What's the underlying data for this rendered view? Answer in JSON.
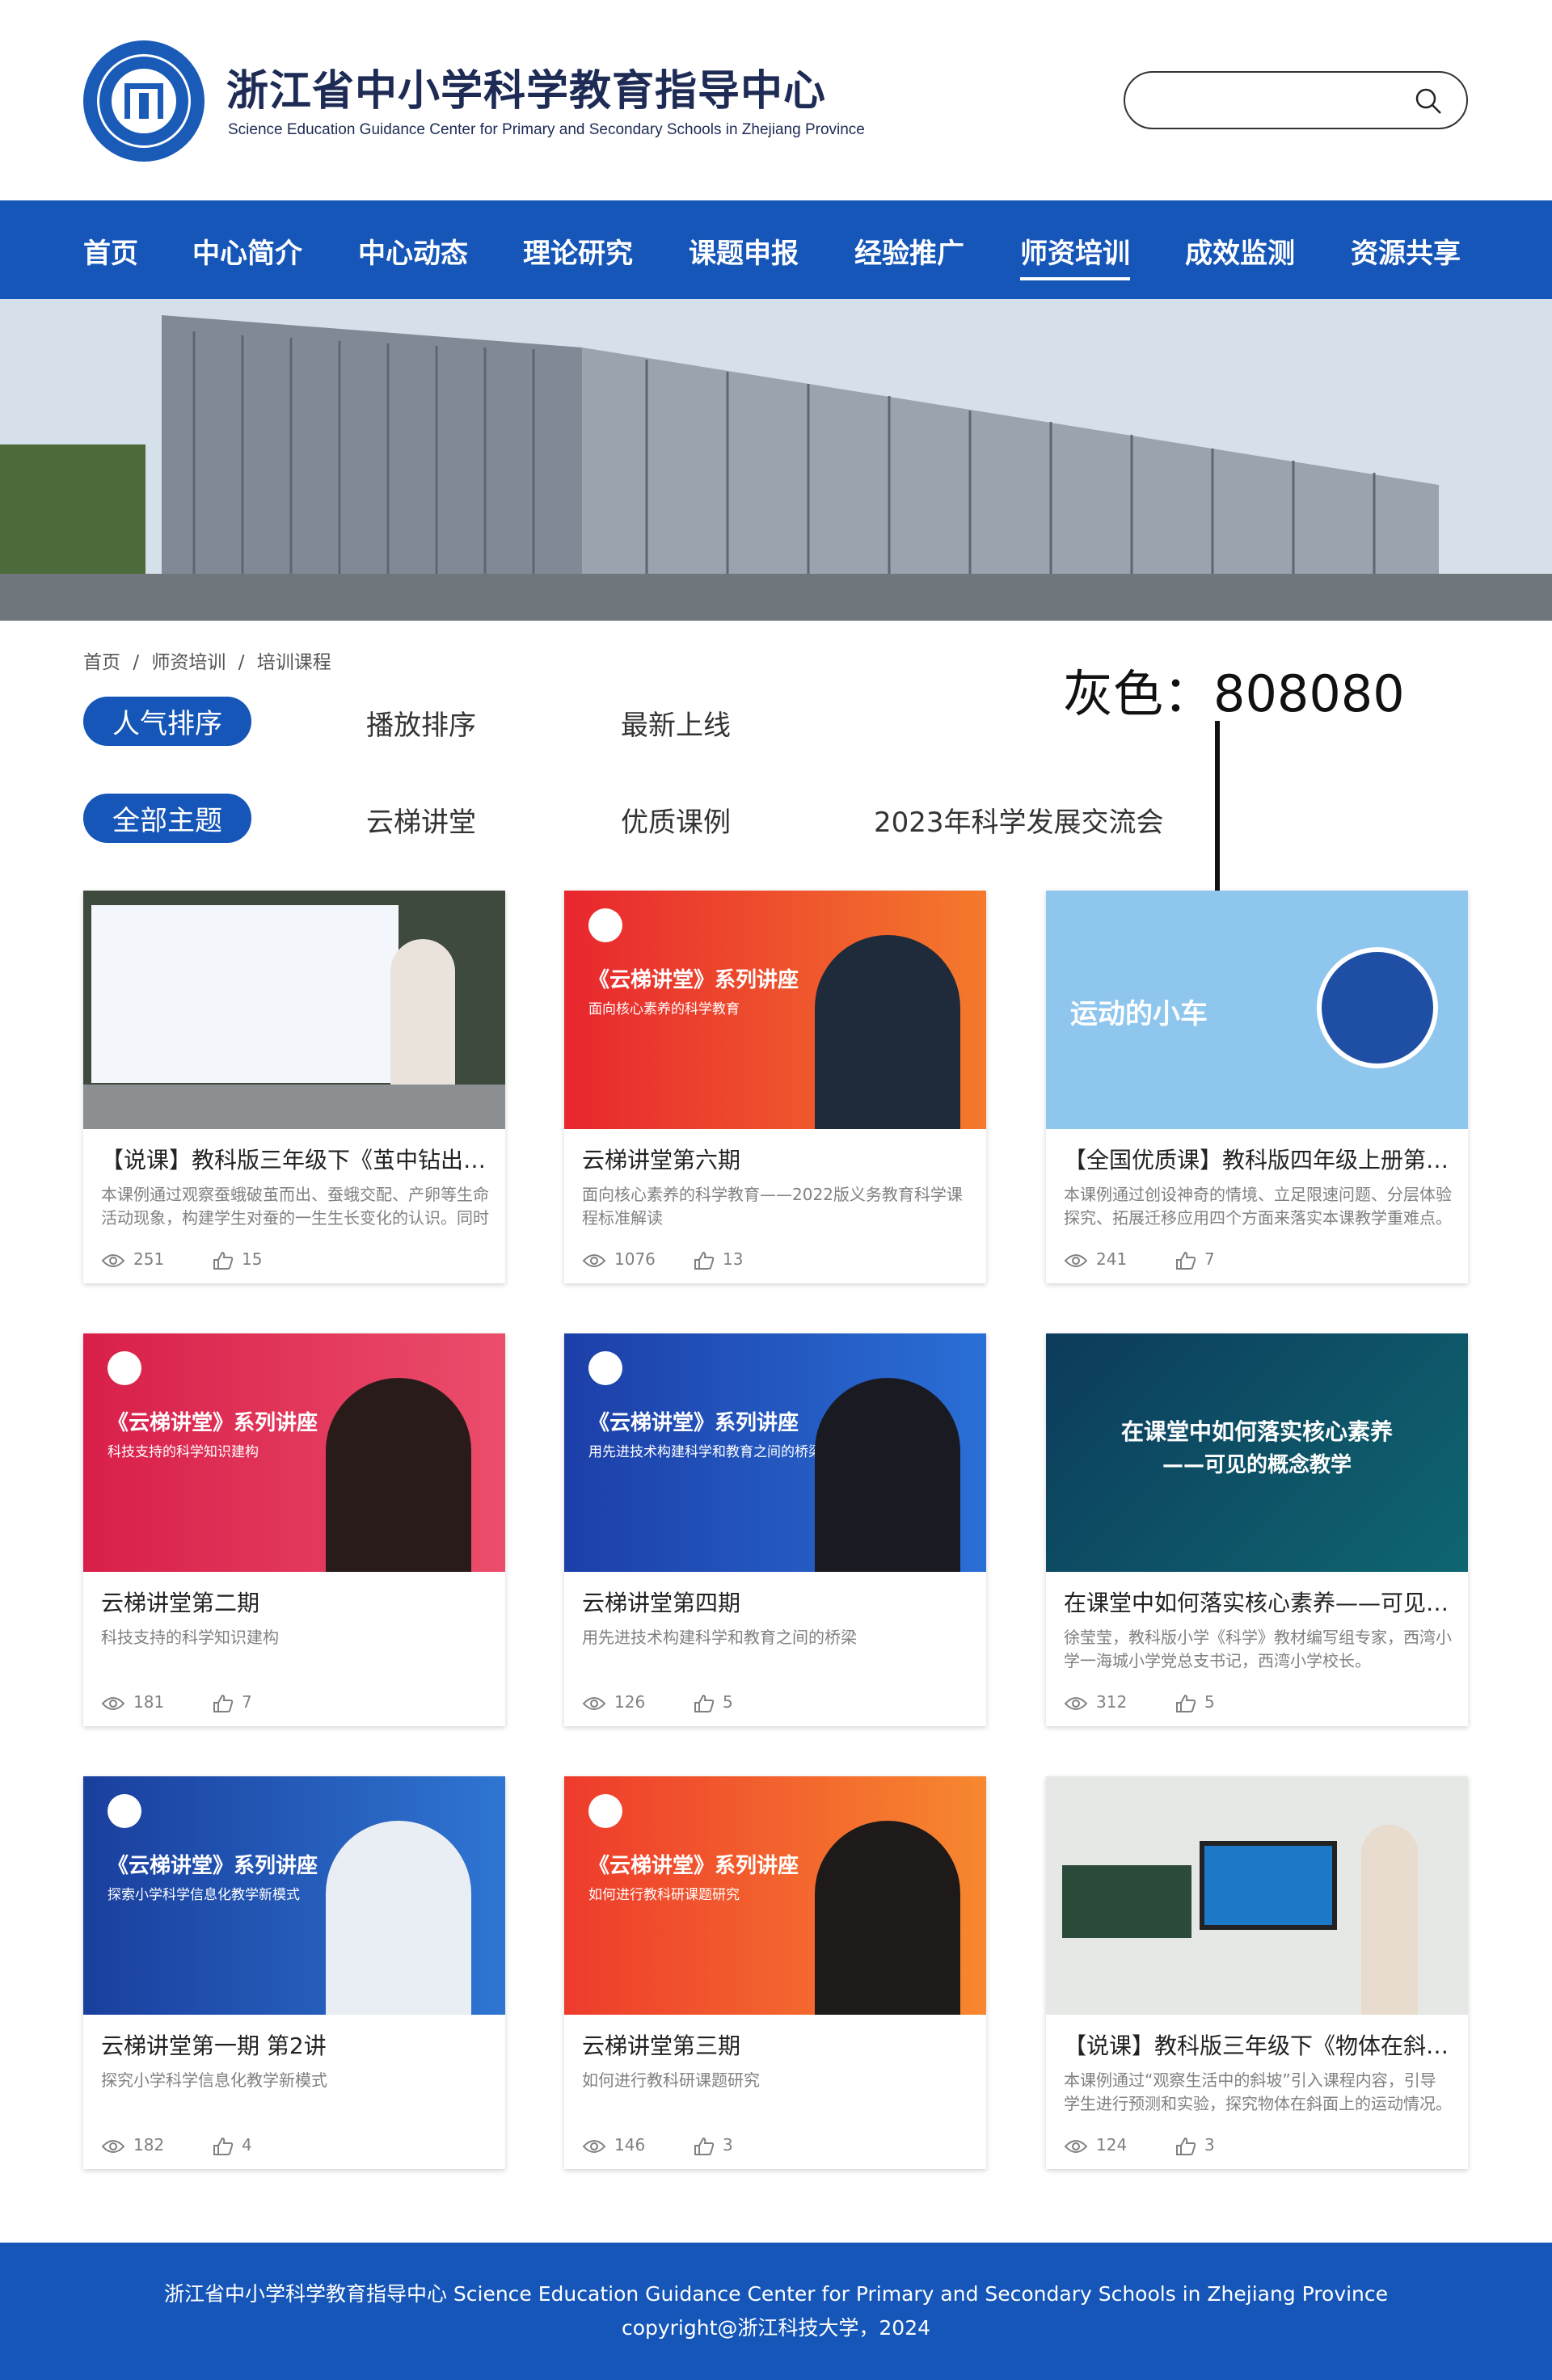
{
  "header": {
    "title": "浙江省中小学科学教育指导中心",
    "subtitle": "Science Education Guidance Center for Primary and Secondary Schools in Zhejiang Province",
    "search_placeholder": ""
  },
  "nav": {
    "items": [
      "首页",
      "中心简介",
      "中心动态",
      "理论研究",
      "课题申报",
      "经验推广",
      "师资培训",
      "成效监测",
      "资源共享"
    ],
    "active": "师资培训"
  },
  "breadcrumb": [
    "首页",
    "/",
    "师资培训",
    "/",
    "培训课程"
  ],
  "annotation": {
    "text": "灰色：808080"
  },
  "sort_filters": [
    "人气排序",
    "播放排序",
    "最新上线"
  ],
  "topic_filters": [
    "全部主题",
    "云梯讲堂",
    "优质课例",
    "2023年科学发展交流会"
  ],
  "colors": {
    "primary": "#1556b8",
    "gray_text": "#808080"
  },
  "cards": [
    {
      "title": "【说课】教科版三年级下《茧中钻出了蛾》",
      "desc": "本课例通过观察蚕蛾破茧而出、蚕蛾交配、产卵等生命活动现象，构建学生对蚕的一生生长变化的认识。同时",
      "views": "251",
      "likes": "15",
      "thumb_title": "",
      "thumb_sub": ""
    },
    {
      "title": "云梯讲堂第六期",
      "desc": "面向核心素养的科学教育——2022版义务教育科学课程标准解读",
      "views": "1076",
      "likes": "13",
      "thumb_title": "《云梯讲堂》系列讲座",
      "thumb_sub": "面向核心素养的科学教育"
    },
    {
      "title": "【全国优质课】教科版四年级上册第三单元",
      "desc": "本课例通过创设神奇的情境、立足限速问题、分层体验探究、拓展迁移应用四个方面来落实本课教学重难点。",
      "views": "241",
      "likes": "7",
      "thumb_title": "运动的小车",
      "thumb_sub": ""
    },
    {
      "title": "云梯讲堂第二期",
      "desc": "科技支持的科学知识建构",
      "views": "181",
      "likes": "7",
      "thumb_title": "《云梯讲堂》系列讲座",
      "thumb_sub": "科技支持的科学知识建构"
    },
    {
      "title": "云梯讲堂第四期",
      "desc": "用先进技术构建科学和教育之间的桥梁",
      "views": "126",
      "likes": "5",
      "thumb_title": "《云梯讲堂》系列讲座",
      "thumb_sub": "用先进技术构建科学和教育之间的桥梁"
    },
    {
      "title": "在课堂中如何落实核心素养——可见的概念教学",
      "desc": "徐莹莹，教科版小学《科学》教材编写组专家，西湾小学一海城小学党总支书记，西湾小学校长。",
      "views": "312",
      "likes": "5",
      "thumb_title": "在课堂中如何落实核心素养",
      "thumb_sub": "——可见的概念教学"
    },
    {
      "title": "云梯讲堂第一期 第2讲",
      "desc": "探究小学科学信息化教学新模式",
      "views": "182",
      "likes": "4",
      "thumb_title": "《云梯讲堂》系列讲座",
      "thumb_sub": "探索小学科学信息化教学新模式"
    },
    {
      "title": "云梯讲堂第三期",
      "desc": "如何进行教科研课题研究",
      "views": "146",
      "likes": "3",
      "thumb_title": "《云梯讲堂》系列讲座",
      "thumb_sub": "如何进行教科研课题研究"
    },
    {
      "title": "【说课】教科版三年级下《物体在斜面上运动》",
      "desc": "本课例通过“观察生活中的斜坡”引入课程内容，引导学生进行预测和实验，探究物体在斜面上的运动情况。",
      "views": "124",
      "likes": "3",
      "thumb_title": "",
      "thumb_sub": ""
    }
  ],
  "footer": {
    "line1": "浙江省中小学科学教育指导中心  Science Education Guidance Center for Primary and Secondary Schools in Zhejiang Province",
    "line2": "copyright@浙江科技大学，2024"
  }
}
